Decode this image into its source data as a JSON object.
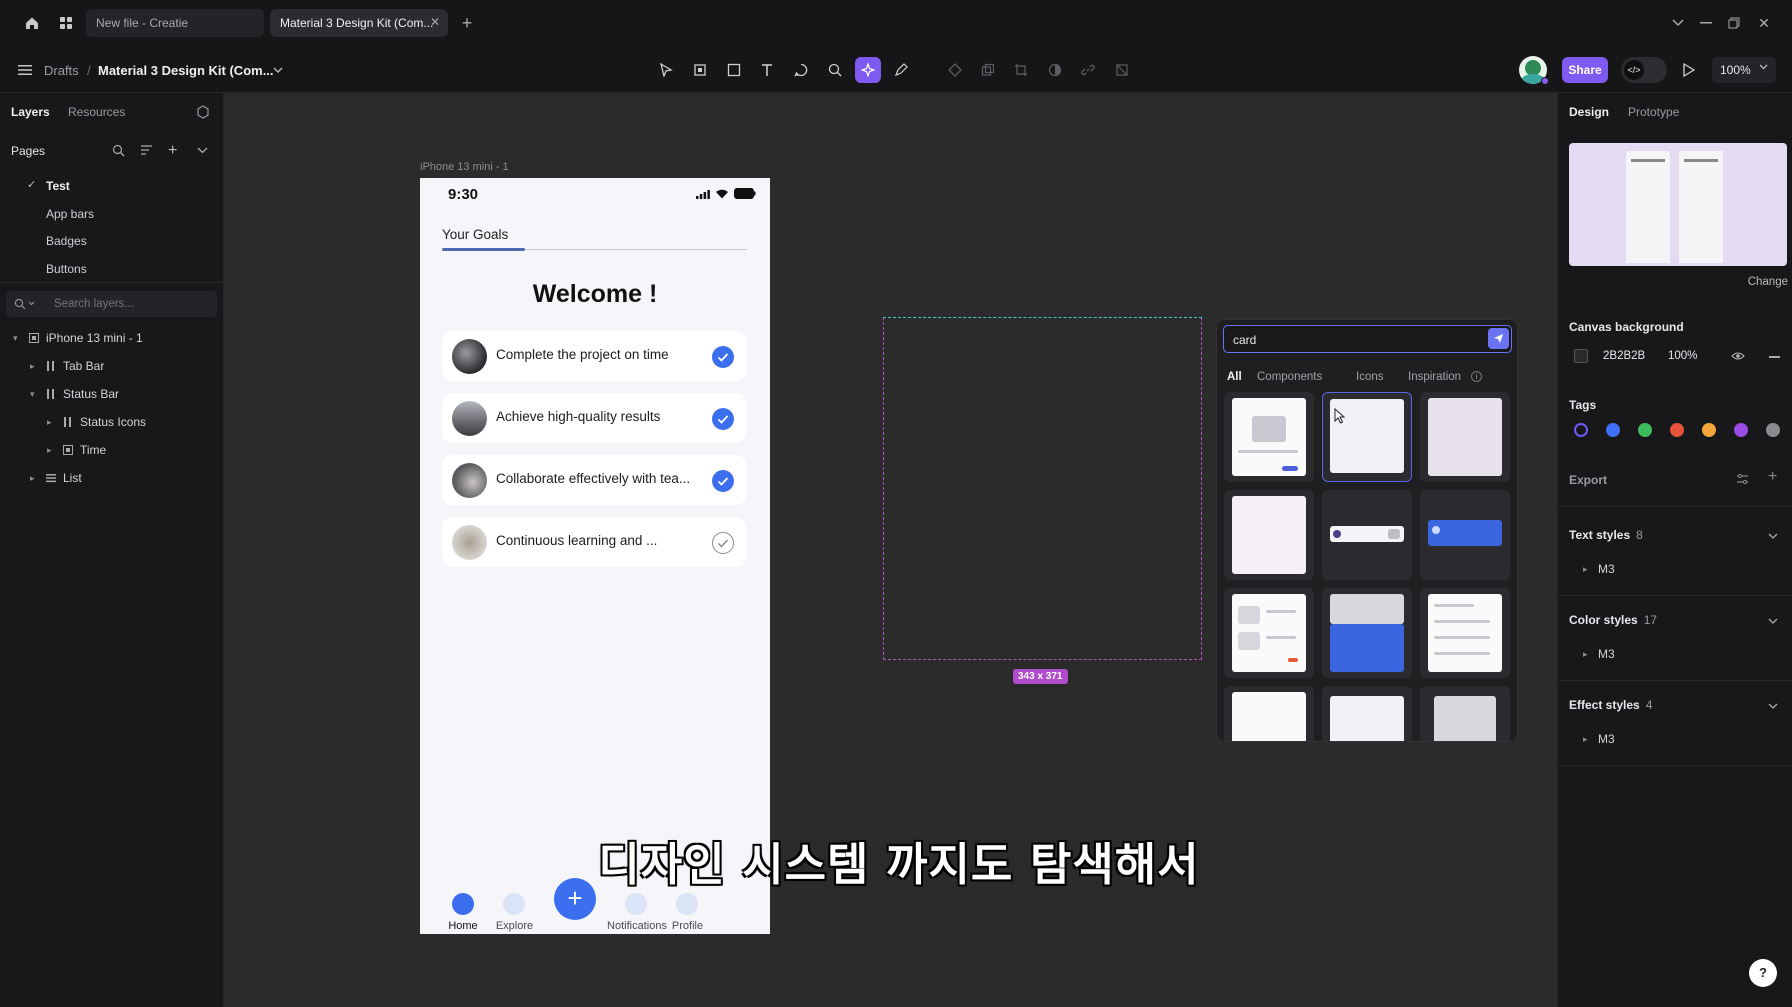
{
  "titlebar": {
    "tabs": [
      {
        "label": "New file - Creatie",
        "active": false
      },
      {
        "label": "Material 3 Design Kit (Com...",
        "active": true
      }
    ]
  },
  "toolbar": {
    "breadcrumb_root": "Drafts",
    "breadcrumb_separator": "/",
    "file_name": "Material 3 Design Kit (Com...",
    "share_label": "Share",
    "zoom_label": "100%",
    "accent": "#7f5af0"
  },
  "left_panel": {
    "tabs": [
      "Layers",
      "Resources"
    ],
    "pages_title": "Pages",
    "pages": [
      "Test",
      "App bars",
      "Badges",
      "Buttons"
    ],
    "search_placeholder": "Search layers...",
    "layers": [
      {
        "label": "iPhone 13 mini - 1",
        "icon": "frame-icon",
        "depth": 0
      },
      {
        "label": "Tab Bar",
        "icon": "columns-icon",
        "depth": 1
      },
      {
        "label": "Status Bar",
        "icon": "columns-icon",
        "depth": 1
      },
      {
        "label": "Status Icons",
        "icon": "columns-icon",
        "depth": 2
      },
      {
        "label": "Time",
        "icon": "frame-icon",
        "depth": 2
      },
      {
        "label": "List",
        "icon": "rows-icon",
        "depth": 1
      }
    ]
  },
  "canvas": {
    "frame_label": "iPhone 13 mini - 1",
    "phone": {
      "time": "9:30",
      "tab_title": "Your Goals",
      "heading": "Welcome !",
      "goals": [
        {
          "text": "Complete the project on time",
          "done": true
        },
        {
          "text": "Achieve high-quality results",
          "done": true
        },
        {
          "text": "Collaborate effectively with tea...",
          "done": true
        },
        {
          "text": "Continuous learning and ...",
          "done": false
        }
      ],
      "nav": [
        "Home",
        "Explore",
        "Notifications",
        "Profile"
      ],
      "fab_symbol": "+"
    },
    "selection_size": "343 x 371",
    "search": {
      "query": "card",
      "filters": [
        "All",
        "Components",
        "Icons",
        "Inspiration"
      ]
    },
    "subtitle": "디자인 시스템 까지도 탐색해서"
  },
  "right_panel": {
    "tabs": [
      "Design",
      "Prototype"
    ],
    "change_label": "Change",
    "canvas_background_title": "Canvas background",
    "canvas_bg_hex": "2B2B2B",
    "canvas_bg_opacity": "100%",
    "tags_title": "Tags",
    "tag_colors": [
      "#6b5cf6",
      "#3f6ff5",
      "#3dbb5a",
      "#e5533a",
      "#f2a53a",
      "#9b4be6",
      "#8a8a8f"
    ],
    "export_title": "Export",
    "text_styles": {
      "title": "Text styles",
      "count": "8",
      "item": "M3"
    },
    "color_styles": {
      "title": "Color styles",
      "count": "17",
      "item": "M3"
    },
    "effect_styles": {
      "title": "Effect styles",
      "count": "4",
      "item": "M3"
    },
    "help_label": "?"
  }
}
